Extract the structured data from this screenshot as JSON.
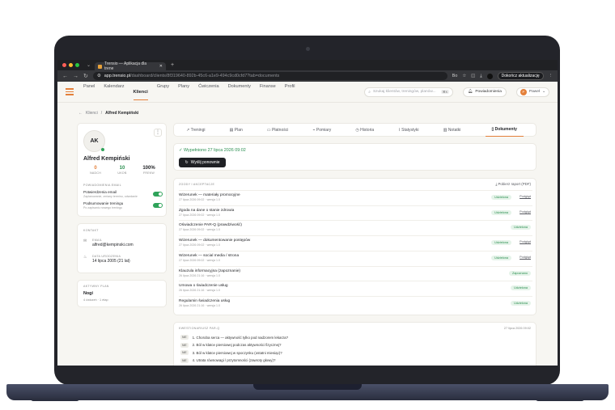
{
  "browser": {
    "tab_title": "Trensio — Aplikacja dla trene",
    "url_host": "app.trensio.pl",
    "url_path": "/dashboard/clients/8f319640-892b-45c6-a1e9-494c9cd0cfd7?tab=documents",
    "lang": "Bo",
    "update_label": "Dokończ aktualizację"
  },
  "nav": {
    "items": [
      "Panel",
      "Kalendarz",
      "Klienci",
      "Grupy",
      "Plany",
      "Ćwiczenia",
      "Dokumenty",
      "Finanse",
      "Profil"
    ],
    "active": "Klienci",
    "search_placeholder": "Szukaj klientów, treningów, planów...",
    "search_kbd": "⌘K",
    "notifications": "Powiadomienia",
    "user_initial": "P",
    "user_name": "Paweł"
  },
  "breadcrumb": {
    "back": "Klienci",
    "current": "Alfred Kempiński"
  },
  "profile": {
    "initials": "AK",
    "name": "Alfred Kempiński",
    "stats": [
      {
        "value": "0",
        "label": "NADCH",
        "color": "#e4803a"
      },
      {
        "value": "10",
        "label": "UKOŃ",
        "color": "#2a8f50"
      },
      {
        "value": "100%",
        "label": "FREKW",
        "color": "#1f2024"
      }
    ],
    "notif_section": "POWIADOMIENIA EMAIL",
    "toggles": [
      {
        "title": "Potwierdzenia email",
        "sub": "Zaplanowanie, zmiany terminu, odwołanie"
      },
      {
        "title": "Podsumowanie treningu",
        "sub": "Po zapisaniu nowego treningu"
      }
    ]
  },
  "contact": {
    "section": "KONTAKT",
    "email_label": "EMAIL",
    "email": "alfred@kempinski.com",
    "dob_label": "DATA URODZENIA",
    "dob": "14 lipca 2005 (21 lat)"
  },
  "plan": {
    "section": "AKTYWNY PLAN",
    "name": "Nogi",
    "detail": "4 ćwiczeń · 1 etap"
  },
  "tabs": [
    "Treningi",
    "Plan",
    "Płatności",
    "Pomiary",
    "Historia",
    "Statystyki",
    "Notatki",
    "Dokumenty"
  ],
  "tabs_active": "Dokumenty",
  "status": {
    "text": "✓ Wypełniono 27 lipca 2026 09:02",
    "resend": "Wyślij ponownie"
  },
  "documents": {
    "section": "ZGODY I AKCEPTACJE",
    "pdf_label": "Pobierz raport (PDF)",
    "accepted": "Udzielona",
    "preview": "Podgląd",
    "rows": [
      {
        "title": "Wizerunek — materiały promocyjne",
        "sub": "27 lipca 2026 09:02 · wersja 1.0",
        "badge": "Udzielona",
        "preview": true
      },
      {
        "title": "Zgoda na dane o stanie zdrowia",
        "sub": "27 lipca 2026 09:02 · wersja 1.0",
        "badge": "Udzielona",
        "preview": true
      },
      {
        "title": "Oświadczenie PAR-Q (prawdziwość)",
        "sub": "27 lipca 2026 09:02 · wersja 1.0",
        "badge": "Udzielona",
        "preview": false
      },
      {
        "title": "Wizerunek — dokumentowanie postępów",
        "sub": "27 lipca 2026 09:02 · wersja 1.0",
        "badge": "Udzielona",
        "preview": true
      },
      {
        "title": "Wizerunek — social media / strona",
        "sub": "27 lipca 2026 09:02 · wersja 1.0",
        "badge": "Udzielona",
        "preview": true
      },
      {
        "title": "Klauzula informacyjna (zapoznanie)",
        "sub": "26 lipca 2026 21:16 · wersja 1.0",
        "badge": "Zapoznano",
        "preview": false
      },
      {
        "title": "Umowa o świadczenie usług",
        "sub": "26 lipca 2026 21:16 · wersja 1.0",
        "badge": "Udzielona",
        "preview": false
      },
      {
        "title": "Regulamin świadczenia usług",
        "sub": "26 lipca 2026 21:16 · wersja 1.0",
        "badge": "Udzielona",
        "preview": false
      }
    ]
  },
  "questionnaire": {
    "section": "KWESTIONARIUSZ PAR-Q",
    "date": "27 lipca 2026 09:02",
    "answer": "NIE",
    "questions": [
      "1. Choroba serca — aktywność tylko pod nadzorem lekarza?",
      "2. Ból w klatce piersiowej podczas aktywności fizycznej?",
      "3. Ból w klatce piersiowej w spoczynku (ostatni miesiąc)?",
      "4. Utrata równowagi / przytomności (zawroty głowy)?"
    ]
  }
}
